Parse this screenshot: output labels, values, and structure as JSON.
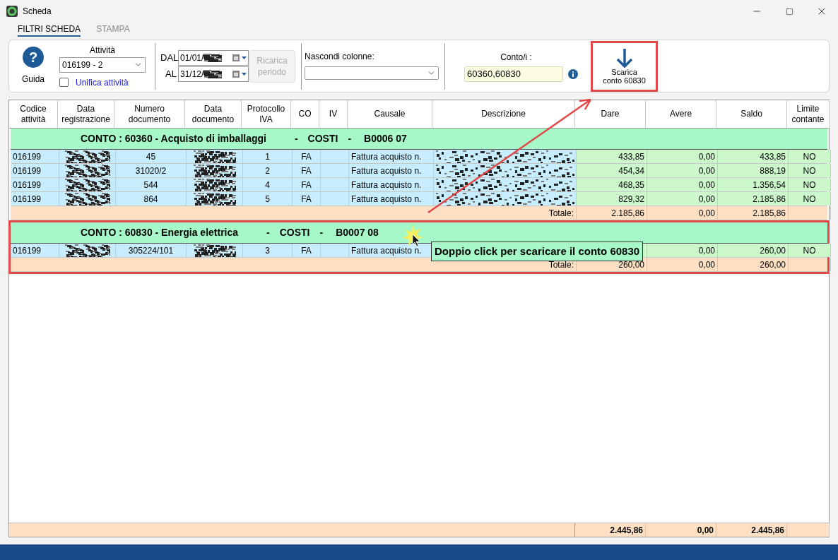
{
  "window": {
    "title": "Scheda"
  },
  "tabs": [
    {
      "label": "FILTRI SCHEDA",
      "selected": true
    },
    {
      "label": "STAMPA",
      "selected": false
    }
  ],
  "filters": {
    "help_icon": "?",
    "help_label": "Guida",
    "activity": {
      "label": "Attività",
      "value": "016199 - 2"
    },
    "unify": {
      "label": "Unifica attività",
      "checked": false
    },
    "from": {
      "label": "DAL",
      "value": "01/01/"
    },
    "to": {
      "label": "AL",
      "value": "31/12/"
    },
    "reload_button": {
      "label": "Ricarica periodo",
      "disabled": true
    },
    "hide_columns": {
      "label": "Nascondi colonne:"
    },
    "accounts": {
      "label": "Conto/i :",
      "value": "60360,60830"
    },
    "download_button": {
      "lines": [
        "Scarica",
        "conto 60830"
      ],
      "highlighted": true
    }
  },
  "table": {
    "columns": [
      "Codice attività",
      "Data registrazione",
      "Numero documento",
      "Data documento",
      "Protocollo IVA",
      "CO",
      "IV",
      "Causale",
      "Descrizione",
      "Dare",
      "Avere",
      "Saldo",
      "Limite contante"
    ],
    "groups": [
      {
        "parts": [
          "CONTO : 60360 - Acquisto di imballaggi",
          "-",
          "COSTI",
          "-",
          "B0006 07"
        ],
        "highlighted": false,
        "rows": [
          {
            "code": "016199",
            "number": "45",
            "protocol": "1",
            "co": "FA",
            "reason": "Fattura acquisto n.",
            "dare": "433,85",
            "avere": "0,00",
            "saldo": "433,85",
            "limit": "NO"
          },
          {
            "code": "016199",
            "number": "31020/2",
            "protocol": "2",
            "co": "FA",
            "reason": "Fattura acquisto n.",
            "dare": "454,34",
            "avere": "0,00",
            "saldo": "888,19",
            "limit": "NO"
          },
          {
            "code": "016199",
            "number": "544",
            "protocol": "4",
            "co": "FA",
            "reason": "Fattura acquisto n.",
            "dare": "468,35",
            "avere": "0,00",
            "saldo": "1.356,54",
            "limit": "NO"
          },
          {
            "code": "016199",
            "number": "864",
            "protocol": "5",
            "co": "FA",
            "reason": "Fattura acquisto n.",
            "dare": "829,32",
            "avere": "0,00",
            "saldo": "2.185,86",
            "limit": "NO"
          }
        ],
        "total": {
          "label": "Totale:",
          "dare": "2.185,86",
          "avere": "0,00",
          "saldo": "2.185,86"
        }
      },
      {
        "parts": [
          "CONTO : 60830 - Energia elettrica",
          "-",
          "COSTI",
          "-",
          "B0007 08"
        ],
        "highlighted": true,
        "rows": [
          {
            "code": "016199",
            "number": "305224/101",
            "protocol": "3",
            "co": "FA",
            "reason": "Fattura acquisto n.",
            "avere": "0,00",
            "saldo": "260,00",
            "limit": "NO"
          }
        ],
        "total": {
          "label": "Totale:",
          "dare": "260,00",
          "avere": "0,00",
          "saldo": "260,00"
        }
      }
    ],
    "grand_total": {
      "dare": "2.445,86",
      "avere": "0,00",
      "saldo": "2.445,86"
    }
  },
  "tooltip": {
    "text": "Doppio click per scaricare il conto 60830"
  }
}
